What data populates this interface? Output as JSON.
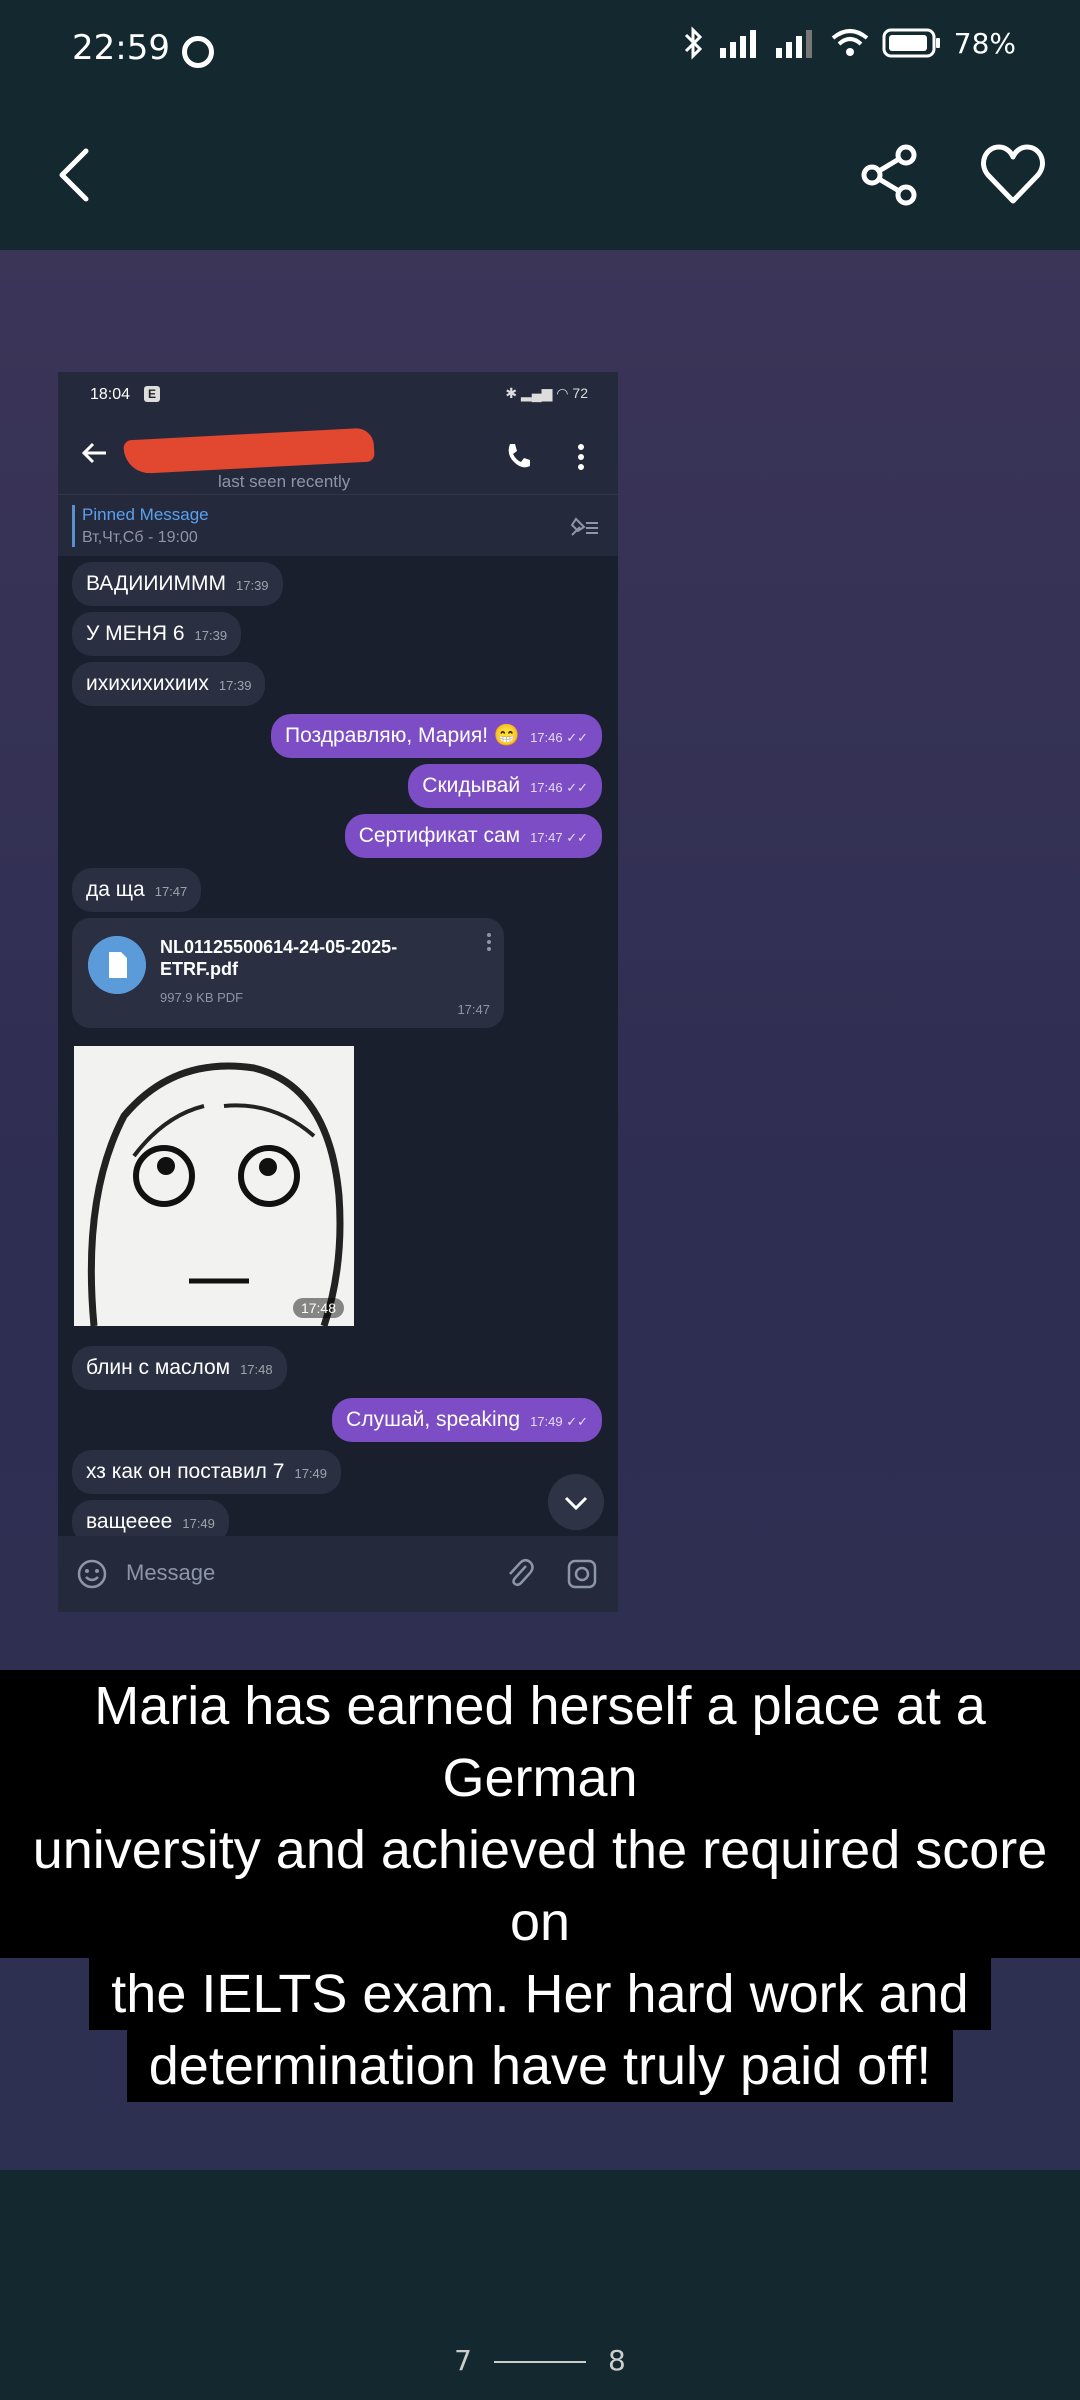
{
  "status_bar": {
    "time": "22:59",
    "battery": "78%"
  },
  "top_bar": {
    "back": "back-icon",
    "share": "share-icon",
    "favorite": "heart-icon"
  },
  "screenshot": {
    "status": {
      "time": "18:04",
      "battery": "72"
    },
    "header": {
      "subtitle": "last seen recently"
    },
    "pinned": {
      "title": "Pinned Message",
      "subtitle": "Вт,Чт,Сб - 19:00"
    },
    "messages": [
      {
        "dir": "in",
        "text": "ВАДИИИМММ",
        "time": "17:39"
      },
      {
        "dir": "in",
        "text": "У МЕНЯ 6",
        "time": "17:39"
      },
      {
        "dir": "in",
        "text": "ихихихихиих",
        "time": "17:39"
      },
      {
        "dir": "out",
        "text": "Поздравляю, Мария! 😁",
        "time": "17:46 ✓✓"
      },
      {
        "dir": "out",
        "text": "Скидывай",
        "time": "17:46 ✓✓"
      },
      {
        "dir": "out",
        "text": "Сертификат сам",
        "time": "17:47 ✓✓"
      },
      {
        "dir": "in",
        "text": "да ща",
        "time": "17:47"
      },
      {
        "dir": "in",
        "text": "блин с маслом",
        "time": "17:48"
      },
      {
        "dir": "out",
        "text": "Слушай, speaking",
        "time": "17:49 ✓✓"
      },
      {
        "dir": "in",
        "text": "хз как он поставил 7",
        "time": "17:49"
      },
      {
        "dir": "in",
        "text": "ващееее",
        "time": "17:49"
      }
    ],
    "file": {
      "name": "NL01125500614-24-05-2025-ETRF.pdf",
      "size": "997.9 KB PDF",
      "time": "17:47"
    },
    "image": {
      "time": "17:48"
    },
    "input": {
      "placeholder": "Message"
    }
  },
  "caption": {
    "lines": [
      "Maria has earned herself a place at a German",
      "university and achieved the required score on",
      "the IELTS exam. Her hard work and",
      "determination have truly paid off!"
    ]
  },
  "pager": {
    "current": "7",
    "next": "8"
  }
}
